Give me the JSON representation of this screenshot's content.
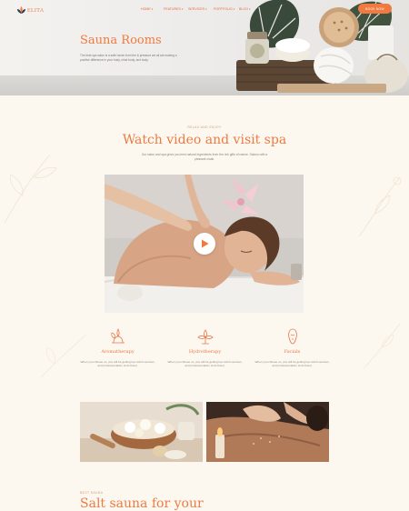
{
  "site": {
    "logo_text": "ELITA"
  },
  "nav": {
    "items": [
      {
        "label": "HOME"
      },
      {
        "label": "FEATURES"
      },
      {
        "label": "SERVICES"
      },
      {
        "label": "PORTFOLIO"
      },
      {
        "label": "BLOG"
      }
    ],
    "book_label": "BOOK NOW"
  },
  "hero": {
    "title": "Sauna Rooms",
    "text": "The best spa salon is a safe haven from the & pressure we all are making a positive difference in your body, mind body, and body."
  },
  "video_section": {
    "tagline": "RELAX AND ENJOY",
    "title": "Watch video and visit spa",
    "intro": "Our salon and spa gives you best natural ingredients from the rich gifts of nature. Salons with a pleasant cloak."
  },
  "features": [
    {
      "icon": "aromatherapy-icon",
      "title": "Aromatherapy",
      "text": "When you choose us, you will be getting top-notch services, and professionalism at its finest."
    },
    {
      "icon": "hydrotherapy-icon",
      "title": "Hydrotherapy",
      "text": "When you choose us, you will be getting top-notch services, and professionalism at its finest."
    },
    {
      "icon": "facials-icon",
      "title": "Facials",
      "text": "When you choose us, you will be getting top-notch services, and professionalism at its finest."
    }
  ],
  "bottom_section": {
    "tagline": "BEST SAUNA",
    "title": "Salt sauna for your"
  },
  "colors": {
    "accent": "#f07a3f",
    "background": "#fdf8ef",
    "muted_text": "#8a837c"
  }
}
